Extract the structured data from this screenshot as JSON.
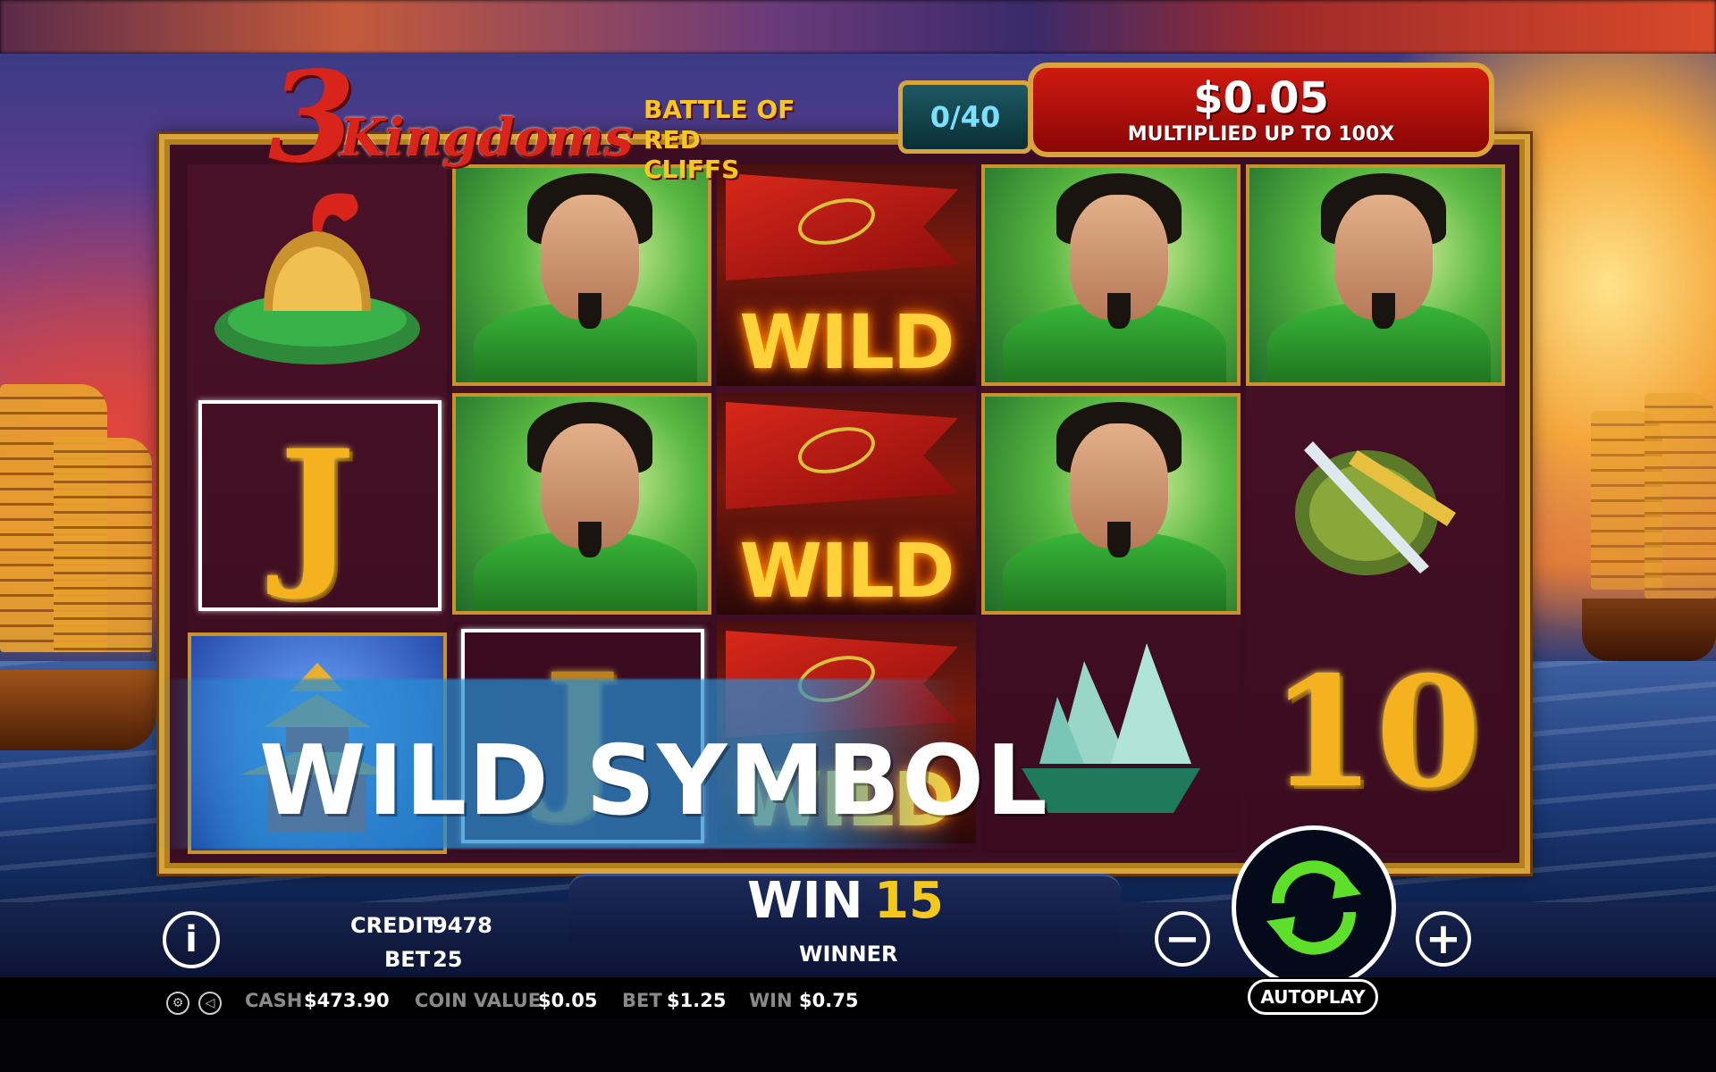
{
  "game": {
    "logo_number": "3",
    "logo_word": "Kingdoms",
    "logo_sub_line1": "BATTLE OF",
    "logo_sub_line2": "RED CLIFFS"
  },
  "free_spins": {
    "counter": "0/40"
  },
  "multiplier": {
    "amount": "$0.05",
    "subtitle": "MULTIPLIED UP TO 100X"
  },
  "reels": {
    "wild_label": "WILD",
    "j_symbol": "J",
    "ten_symbol": "10"
  },
  "overlay": {
    "text": "WILD SYMBOL"
  },
  "panel": {
    "credit_label": "CREDIT",
    "credit_value": "9478",
    "bet_label": "BET",
    "bet_value": "25",
    "win_label": "WIN",
    "win_value": "15",
    "winner_label": "WINNER",
    "info_icon": "i",
    "minus_icon": "−",
    "plus_icon": "+",
    "autoplay_label": "AUTOPLAY"
  },
  "status": {
    "cash_label": "CASH",
    "cash_value": "$473.90",
    "coin_value_label": "COIN VALUE",
    "coin_value": "$0.05",
    "bet_label": "BET",
    "bet_value": "$1.25",
    "win_label": "WIN",
    "win_value": "$0.75"
  },
  "icons": {
    "settings": "gear-icon",
    "sound": "speaker-icon",
    "spin": "spin-arrows-icon"
  },
  "colors": {
    "gold_frame": "#d9a53a",
    "spin_green": "#5ee02a",
    "win_value": "#f4c81e",
    "banner_red": "#d01a10"
  }
}
